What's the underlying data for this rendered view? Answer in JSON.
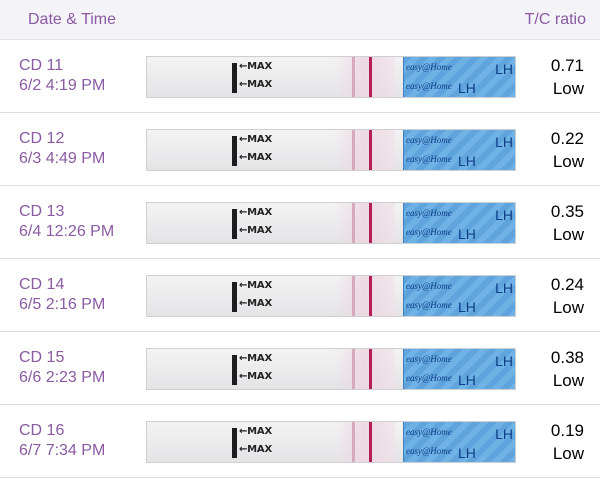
{
  "header": {
    "date_time": "Date & Time",
    "tc_ratio": "T/C ratio"
  },
  "strip_text": {
    "max_label": "←MAX",
    "brand": "easy@Home",
    "lh": "LH"
  },
  "rows": [
    {
      "cd": "CD 11",
      "datetime": "6/2 4:19 PM",
      "ratio": "0.71",
      "level": "Low"
    },
    {
      "cd": "CD 12",
      "datetime": "6/3 4:49 PM",
      "ratio": "0.22",
      "level": "Low"
    },
    {
      "cd": "CD 13",
      "datetime": "6/4 12:26 PM",
      "ratio": "0.35",
      "level": "Low"
    },
    {
      "cd": "CD 14",
      "datetime": "6/5 2:16 PM",
      "ratio": "0.24",
      "level": "Low"
    },
    {
      "cd": "CD 15",
      "datetime": "6/6 2:23 PM",
      "ratio": "0.38",
      "level": "Low"
    },
    {
      "cd": "CD 16",
      "datetime": "6/7 7:34 PM",
      "ratio": "0.19",
      "level": "Low"
    }
  ],
  "colors": {
    "accent": "#8a5aa3",
    "control_line": "#b21e55",
    "test_line": "#d8a9bd",
    "handle_blue": "#5fa4dd"
  }
}
